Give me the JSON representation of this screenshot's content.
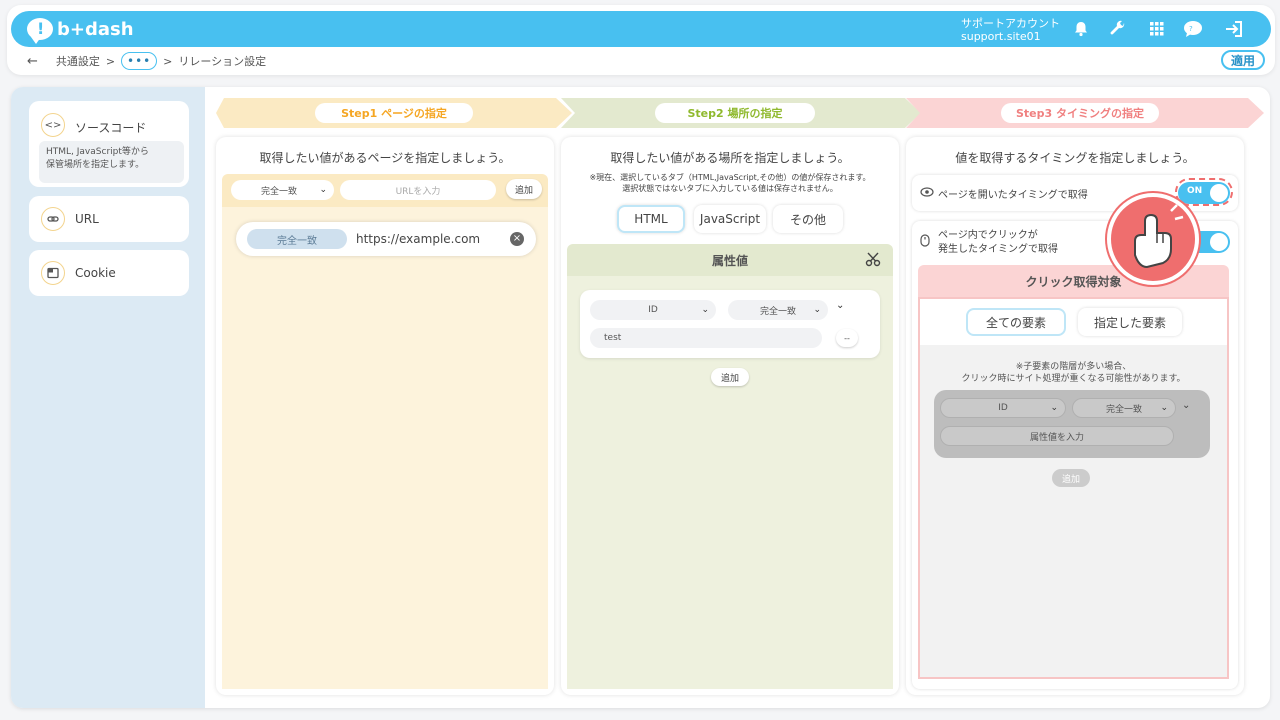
{
  "app": {
    "logo_text": "b+dash"
  },
  "account": {
    "line1": "サポートアカウント",
    "line2": "support.site01"
  },
  "topbar_icons": [
    "bell-icon",
    "wrench-icon",
    "grid-icon",
    "chat-icon",
    "logout-icon"
  ],
  "breadcrumb": {
    "back": "←",
    "item1": "共通設定",
    "sep1": ">",
    "dots": "•••",
    "sep2": ">",
    "current": "リレーション設定"
  },
  "apply_label": "適用",
  "sidebar": {
    "items": [
      {
        "label": "ソースコード",
        "icon": "code-icon",
        "desc_line1": "HTML, JavaScript等から",
        "desc_line2": "保管場所を指定します。"
      },
      {
        "label": "URL",
        "icon": "link-icon"
      },
      {
        "label": "Cookie",
        "icon": "cookie-icon"
      }
    ]
  },
  "steps": [
    {
      "label": "Step1 ページの指定",
      "color": "#f5a623"
    },
    {
      "label": "Step2 場所の指定",
      "color": "#8fb92d"
    },
    {
      "label": "Step3 タイミングの指定",
      "color": "#f08080"
    }
  ],
  "col1": {
    "title": "取得したい値があるページを指定しましょう。",
    "match_select": "完全一致",
    "url_placeholder": "URLを入力",
    "add_label": "追加",
    "entry": {
      "match": "完全一致",
      "url": "https://example.com"
    }
  },
  "col2": {
    "title": "取得したい値がある場所を指定しましょう。",
    "note_line1": "※現在、選択しているタブ（HTML,JavaScript,その他）の値が保存されます。",
    "note_line2": "選択状態ではないタブに入力している値は保存されません。",
    "tabs": [
      "HTML",
      "JavaScript",
      "その他"
    ],
    "section_title": "属性値",
    "attr_type": "ID",
    "attr_match": "完全一致",
    "attr_value": "test",
    "add_label": "追加"
  },
  "col3": {
    "title": "値を取得するタイミングを指定しましょう。",
    "option1": "ページを開いたタイミングで取得",
    "option1_toggle": "ON",
    "option2_line1": "ページ内でクリックが",
    "option2_line2": "発生したタイミングで取得",
    "target_title": "クリック取得対象",
    "target_tabs": [
      "全ての要素",
      "指定した要素"
    ],
    "warn_line1": "※子要素の階層が多い場合、",
    "warn_line2": "クリック時にサイト処理が重くなる可能性があります。",
    "attr_type": "ID",
    "attr_match": "完全一致",
    "attr_placeholder": "属性値を入力",
    "add_label": "追加"
  }
}
